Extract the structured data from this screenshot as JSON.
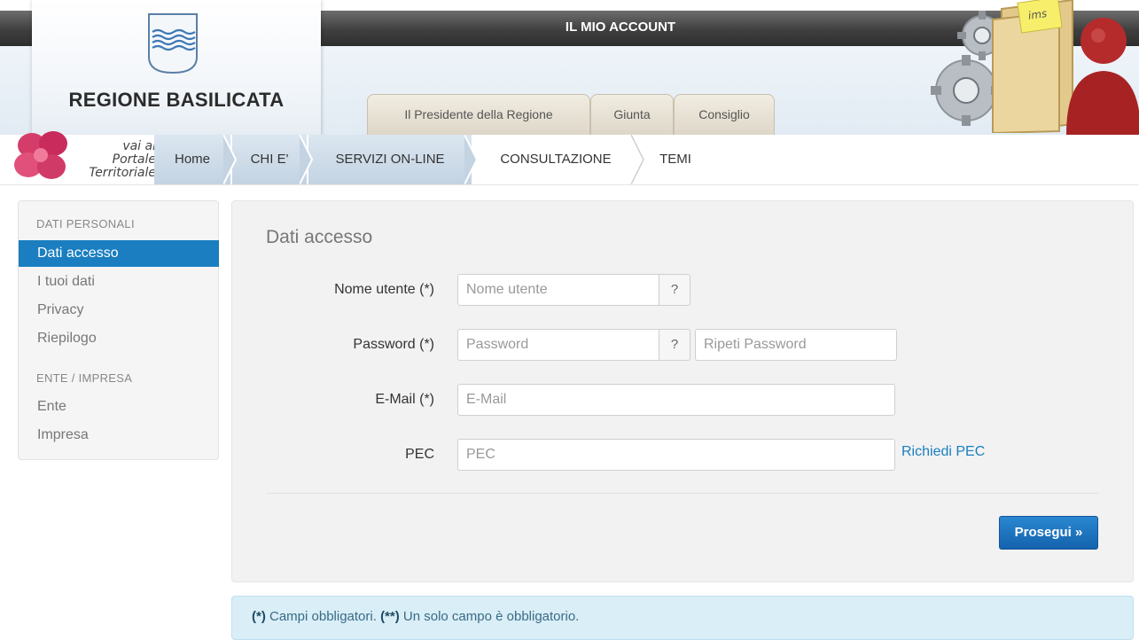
{
  "header": {
    "region_name": "REGIONE BASILICATA",
    "account_title": "IL MIO ACCOUNT",
    "badge_text": "ims",
    "tabs": [
      {
        "label": "Il Presidente della Regione"
      },
      {
        "label": "Giunta"
      },
      {
        "label": "Consiglio"
      }
    ]
  },
  "nav": {
    "portal_link": {
      "line1": "vai al",
      "line2": "Portale",
      "line3": "Territoriale"
    },
    "crumbs": [
      {
        "label": "Home"
      },
      {
        "label": "CHI E'"
      },
      {
        "label": "SERVIZI ON-LINE"
      },
      {
        "label": "CONSULTAZIONE"
      },
      {
        "label": "TEMI"
      }
    ]
  },
  "sidebar": {
    "section1": "DATI PERSONALI",
    "items1": [
      {
        "label": "Dati accesso",
        "active": true
      },
      {
        "label": "I tuoi dati"
      },
      {
        "label": "Privacy"
      },
      {
        "label": "Riepilogo"
      }
    ],
    "section2": "ENTE / IMPRESA",
    "items2": [
      {
        "label": "Ente"
      },
      {
        "label": "Impresa"
      }
    ]
  },
  "form": {
    "title": "Dati accesso",
    "username": {
      "label": "Nome utente (*)",
      "placeholder": "Nome utente",
      "help": "?"
    },
    "password": {
      "label": "Password (*)",
      "placeholder": "Password",
      "help": "?",
      "repeat_placeholder": "Ripeti Password"
    },
    "email": {
      "label": "E-Mail (*)",
      "placeholder": "E-Mail"
    },
    "pec": {
      "label": "PEC",
      "placeholder": "PEC",
      "link": "Richiedi PEC"
    },
    "submit": "Prosegui »"
  },
  "info": {
    "mark1": "(*)",
    "text1": " Campi obbligatori. ",
    "mark2": "(**)",
    "text2": " Un solo campo è obbligatorio."
  },
  "colors": {
    "accent": "#1a7ec0",
    "header_dark": "#3f3f3f",
    "info_bg": "#d9eef7"
  }
}
